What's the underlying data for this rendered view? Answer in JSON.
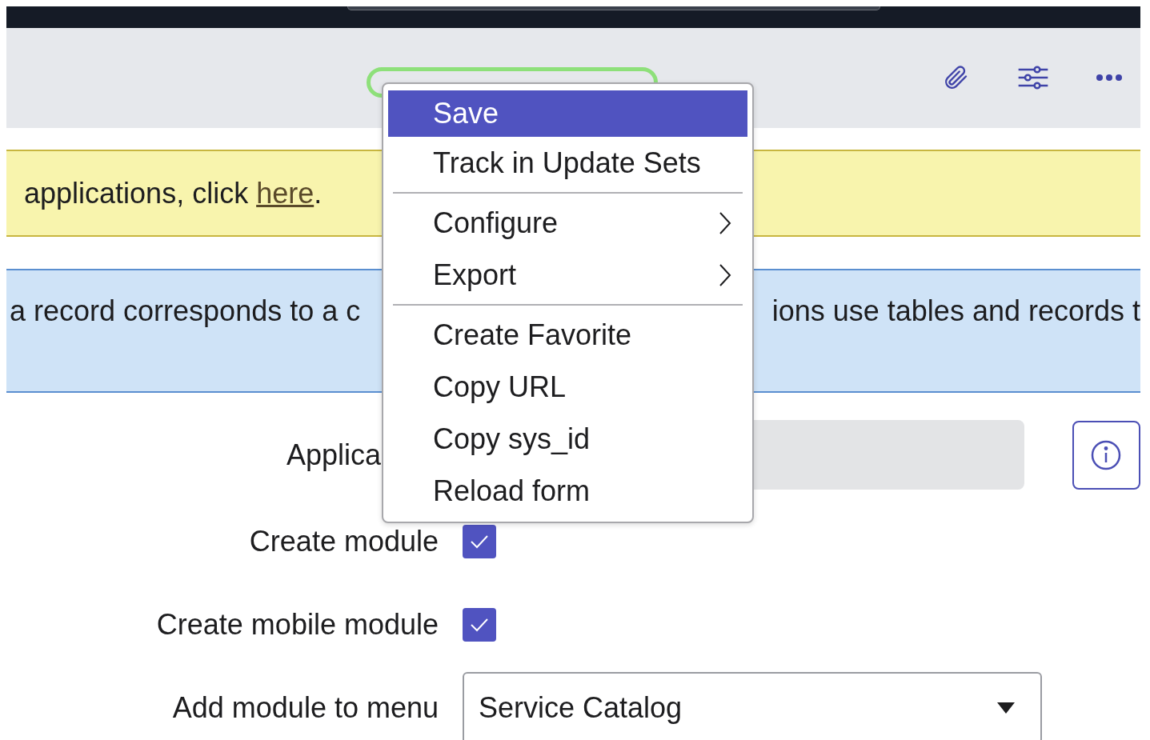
{
  "notice": {
    "text": "applications, click ",
    "link": "here",
    "end": "."
  },
  "info_banner": {
    "left_text": "a record corresponds to a c",
    "right_text": "ions use tables and records t"
  },
  "form": [
    {
      "label": "Applica",
      "kind": "readonly"
    },
    {
      "label": "Create module",
      "kind": "checkbox",
      "checked": true
    },
    {
      "label": "Create mobile module",
      "kind": "checkbox",
      "checked": true
    },
    {
      "label": "Add module to menu",
      "kind": "select",
      "value": "Service Catalog"
    }
  ],
  "menu": {
    "groups": [
      [
        {
          "label": "Save",
          "kind": "item",
          "selected": true
        },
        {
          "label": "Track in Update Sets",
          "kind": "item",
          "selected": false
        }
      ],
      [
        {
          "label": "Configure",
          "kind": "submenu",
          "selected": false
        },
        {
          "label": "Export",
          "kind": "submenu",
          "selected": false
        }
      ],
      [
        {
          "label": "Create Favorite",
          "kind": "item",
          "selected": false
        },
        {
          "label": "Copy URL",
          "kind": "item",
          "selected": false
        },
        {
          "label": "Copy sys_id",
          "kind": "item",
          "selected": false
        },
        {
          "label": "Reload form",
          "kind": "item",
          "selected": false
        }
      ]
    ]
  }
}
